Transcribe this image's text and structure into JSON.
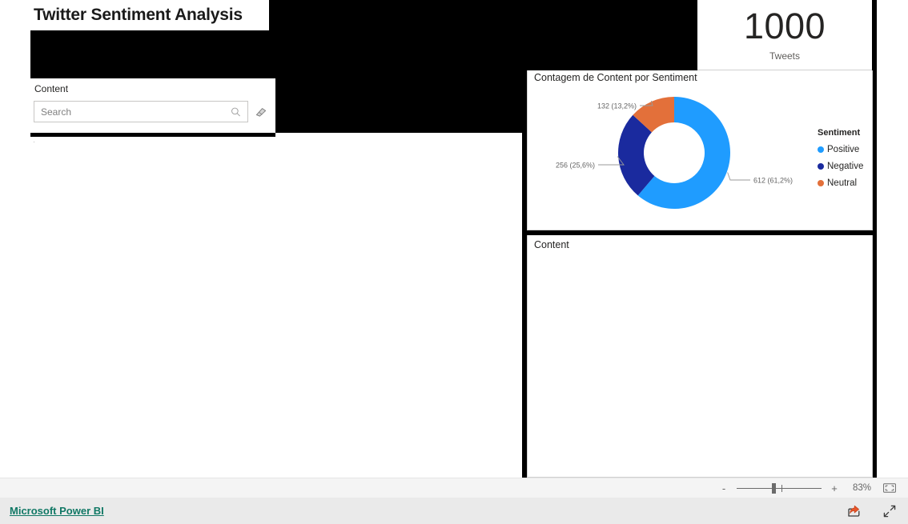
{
  "report": {
    "title": "Twitter Sentiment Analysis"
  },
  "slicer": {
    "title": "Content",
    "search_placeholder": "Search",
    "search_value": "",
    "search_icon": "search-icon",
    "clear_icon": "eraser-icon",
    "mark": "·"
  },
  "kpi": {
    "value": "1000",
    "label": "Tweets"
  },
  "donut": {
    "title": "Contagem de Content por Sentiment",
    "legend_title": "Sentiment"
  },
  "table": {
    "header": "Content",
    "rows": []
  },
  "status_bar": {
    "zoom_out_label": "-",
    "zoom_in_label": "+",
    "zoom_percent": "83%",
    "fit_icon": "fit-to-page-icon"
  },
  "footer": {
    "link_label": "Microsoft Power BI",
    "share_icon": "share-icon",
    "fullscreen_icon": "fullscreen-icon"
  },
  "chart_data": {
    "type": "pie",
    "title": "Contagem de Content por Sentiment",
    "legend_title": "Sentiment",
    "legend_position": "right",
    "donut": true,
    "total": 1000,
    "categories": [
      "Positive",
      "Negative",
      "Neutral"
    ],
    "values": [
      612,
      256,
      132
    ],
    "percents": [
      61.2,
      25.6,
      13.2
    ],
    "labels": [
      "612 (61,2%)",
      "256 (25,6%)",
      "132 (13,2%)"
    ],
    "colors": [
      "#1f9cff",
      "#1a2a9e",
      "#e3703a"
    ],
    "start_angle_deg": 0,
    "direction": "clockwise"
  }
}
